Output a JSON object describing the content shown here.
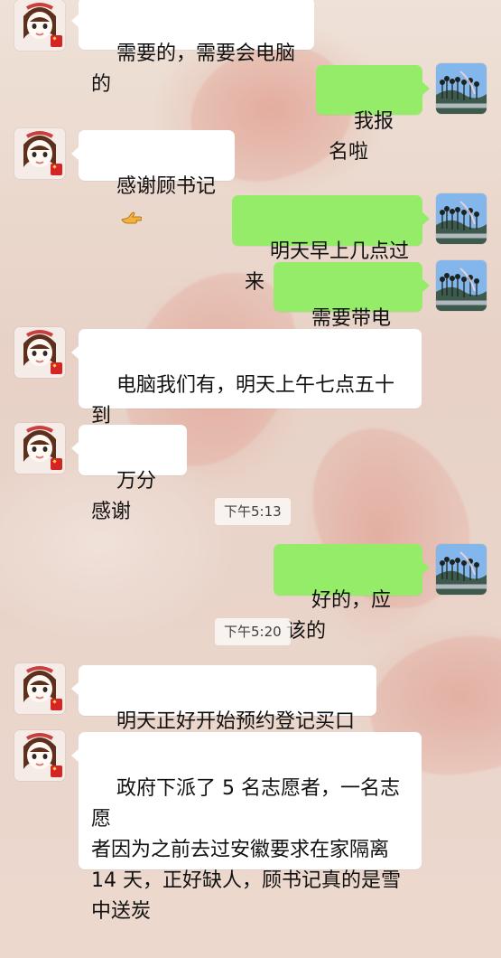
{
  "chat": {
    "messages": [
      {
        "side": "left",
        "text": "需要的，需要会电脑的",
        "avatar": "girl-avatar"
      },
      {
        "side": "right",
        "text": "我报名啦",
        "avatar": "landscape-avatar"
      },
      {
        "side": "left",
        "text": "感谢顾书记",
        "avatar": "girl-avatar",
        "emoji": "pointing-hand-emoji"
      },
      {
        "side": "right",
        "text": "明天早上几点过来",
        "avatar": "landscape-avatar"
      },
      {
        "side": "right",
        "text": "需要带电脑吗",
        "avatar": "landscape-avatar"
      },
      {
        "side": "left",
        "text": "电脑我们有，明天上午七点五十到\n村",
        "avatar": "girl-avatar"
      },
      {
        "side": "left",
        "text": "万分感谢",
        "avatar": "girl-avatar"
      },
      {
        "side": "time",
        "text": "下午5:13"
      },
      {
        "side": "right",
        "text": "好的，应该的",
        "avatar": "landscape-avatar"
      },
      {
        "side": "time",
        "text": "下午5:20"
      },
      {
        "side": "left",
        "text": "明天正好开始预约登记买口罩",
        "avatar": "girl-avatar"
      },
      {
        "side": "left",
        "text": "政府下派了 5 名志愿者，一名志愿\n者因为之前去过安徽要求在家隔离\n14 天，正好缺人，顾书记真的是雪\n中送炭",
        "avatar": "girl-avatar"
      }
    ]
  },
  "colors": {
    "incoming_bubble": "#ffffff",
    "outgoing_bubble": "#95ec69",
    "time_chip": "#ffffff"
  }
}
